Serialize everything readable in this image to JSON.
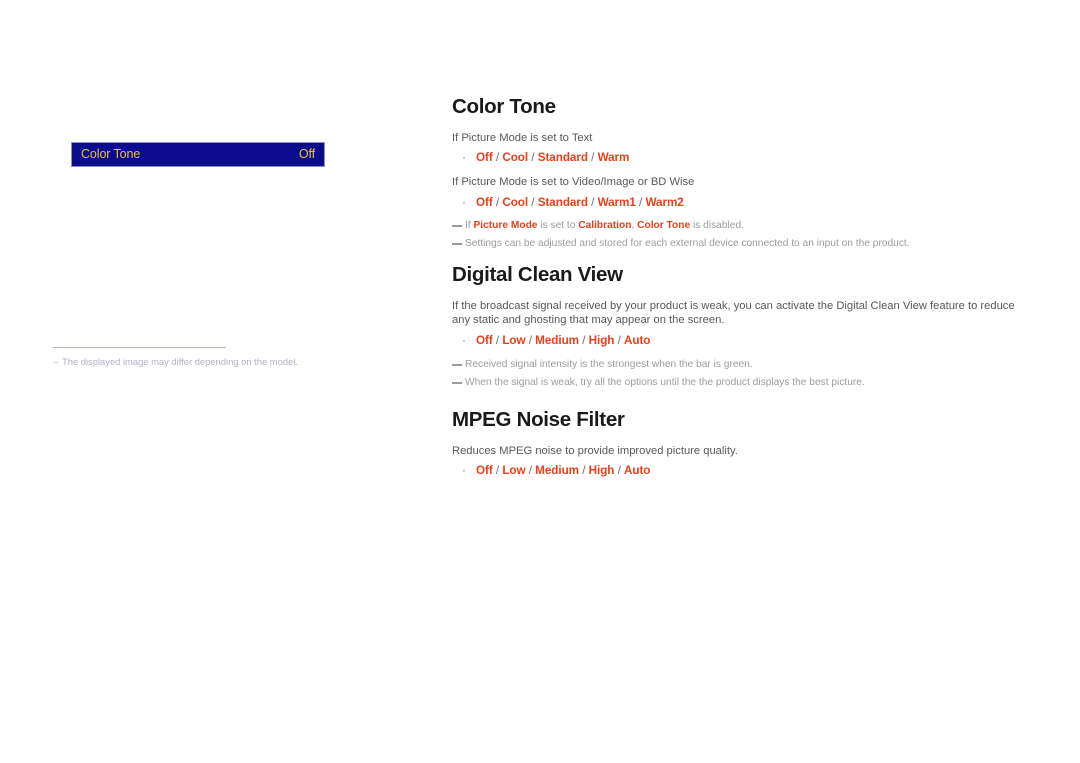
{
  "colors": {
    "accent_red": "#e8401a",
    "osd_background": "#0b0b8c",
    "osd_text": "#e8c13c",
    "osd_border": "#8e8ec4",
    "note_gray": "#9c9c9e",
    "body_gray": "#58585a",
    "heading_black": "#1a1a1a",
    "left_note_gray": "#b0b2c6"
  },
  "osd": {
    "name": "color-tone-osd-row",
    "label": "Color Tone",
    "value": "Off"
  },
  "left_note": {
    "marker": "–",
    "text": "The displayed image may differ depending on the model."
  },
  "sections": [
    {
      "id": "color-tone",
      "heading": "Color Tone",
      "lines": [
        {
          "type": "condition",
          "parts": [
            {
              "text": "If ",
              "style": "plain"
            },
            {
              "text": "Picture Mode",
              "style": "accent"
            },
            {
              "text": " is set to ",
              "style": "plain"
            },
            {
              "text": "Text",
              "style": "accent"
            }
          ]
        },
        {
          "type": "bullet",
          "marker": "·",
          "options": [
            "Off",
            "Cool",
            "Standard",
            "Warm"
          ],
          "separator": "/"
        },
        {
          "type": "condition",
          "parts": [
            {
              "text": "If ",
              "style": "plain"
            },
            {
              "text": "Picture Mode",
              "style": "accent"
            },
            {
              "text": " is set to ",
              "style": "plain"
            },
            {
              "text": "Video/Image",
              "style": "accent"
            },
            {
              "text": " or ",
              "style": "plain"
            },
            {
              "text": "BD Wise",
              "style": "accent"
            }
          ]
        },
        {
          "type": "bullet",
          "marker": "·",
          "options": [
            "Off",
            "Cool",
            "Standard",
            "Warm1",
            "Warm2"
          ],
          "separator": "/"
        },
        {
          "type": "note",
          "parts": [
            {
              "text": "If ",
              "style": "note"
            },
            {
              "text": "Picture Mode",
              "style": "accent"
            },
            {
              "text": " is set to ",
              "style": "note"
            },
            {
              "text": "Calibration",
              "style": "accent"
            },
            {
              "text": ", ",
              "style": "note"
            },
            {
              "text": "Color Tone",
              "style": "accent"
            },
            {
              "text": " is disabled.",
              "style": "note"
            }
          ]
        },
        {
          "type": "note",
          "parts": [
            {
              "text": "Settings can be adjusted and stored for each external device connected to an input on the product.",
              "style": "note"
            }
          ]
        }
      ]
    },
    {
      "id": "digital-clean-view",
      "heading": "Digital Clean View",
      "lines": [
        {
          "type": "paragraph",
          "parts": [
            {
              "text": "If the broadcast signal received by your product is weak, you can activate the ",
              "style": "plain"
            },
            {
              "text": "Digital Clean View",
              "style": "accent"
            },
            {
              "text": " feature to reduce any static and ghosting that may appear on the screen.",
              "style": "plain"
            }
          ]
        },
        {
          "type": "bullet",
          "marker": "·",
          "options": [
            "Off",
            "Low",
            "Medium",
            "High",
            "Auto"
          ],
          "separator": "/"
        },
        {
          "type": "note",
          "parts": [
            {
              "text": "Received signal intensity is the strongest when the bar is green.",
              "style": "note"
            }
          ]
        },
        {
          "type": "note",
          "parts": [
            {
              "text": "When the signal is weak, try all the options until the the product displays the best picture.",
              "style": "note"
            }
          ]
        }
      ]
    },
    {
      "id": "mpeg-noise-filter",
      "heading": "MPEG Noise Filter",
      "lines": [
        {
          "type": "paragraph",
          "parts": [
            {
              "text": "Reduces MPEG noise to provide improved picture quality.",
              "style": "plain"
            }
          ]
        },
        {
          "type": "bullet",
          "marker": "·",
          "options": [
            "Off",
            "Low",
            "Medium",
            "High",
            "Auto"
          ],
          "separator": "/"
        }
      ]
    }
  ]
}
